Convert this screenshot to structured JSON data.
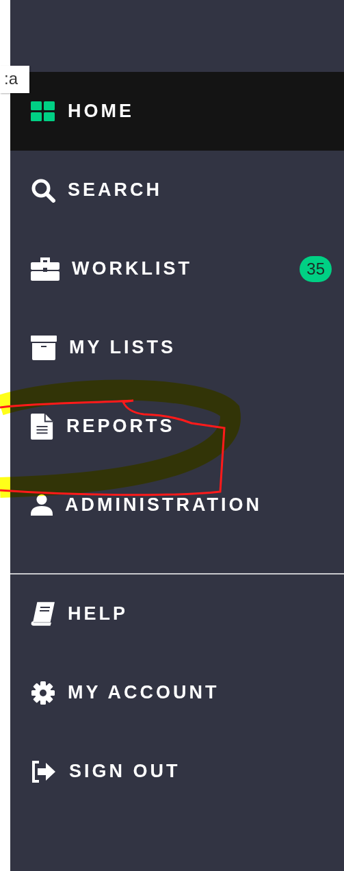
{
  "tooltip": {
    "text": ":a"
  },
  "main_menu": [
    {
      "label": "HOME",
      "selected": true
    },
    {
      "label": "SEARCH",
      "selected": false
    },
    {
      "label": "WORKLIST",
      "selected": false,
      "badge": "35"
    },
    {
      "label": "MY LISTS",
      "selected": false
    },
    {
      "label": "REPORTS",
      "selected": false
    },
    {
      "label": "ADMINISTRATION",
      "selected": false
    }
  ],
  "account_menu": [
    {
      "label": "HELP",
      "selected": false
    },
    {
      "label": "MY ACCOUNT",
      "selected": false
    },
    {
      "label": "SIGN OUT",
      "selected": false
    }
  ]
}
